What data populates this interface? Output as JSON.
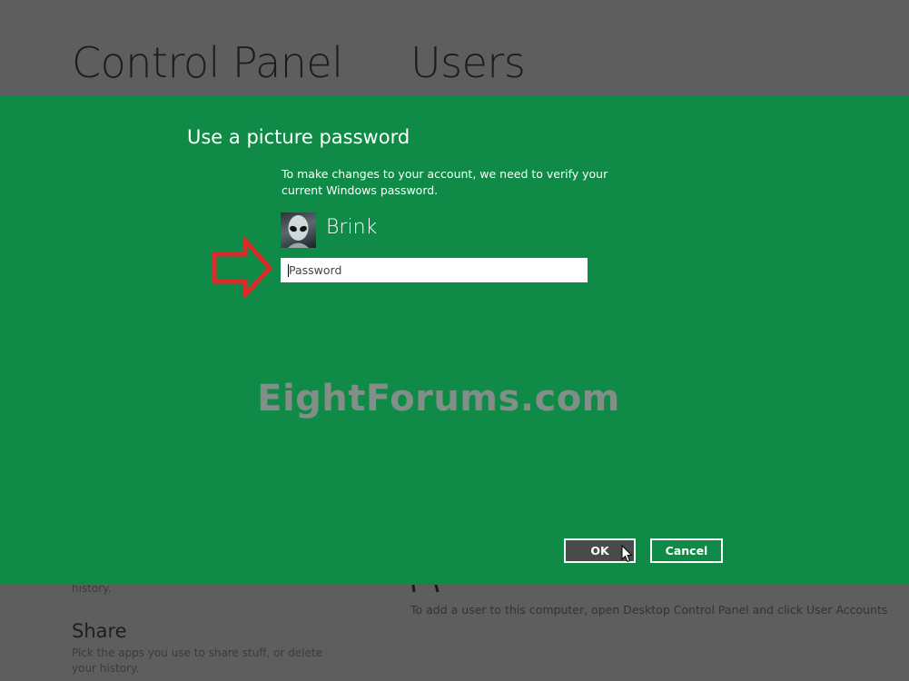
{
  "background": {
    "title_left": "Control Panel",
    "title_right": "Users",
    "fragment": "history.",
    "share": {
      "heading": "Share",
      "description": "Pick the apps you use to share stuff, or delete your history."
    },
    "add_user_text": "To add a user to this computer, open Desktop Control Panel and click User Accounts"
  },
  "dialog": {
    "title": "Use a picture password",
    "message": "To make changes to your account, we need to verify your current Windows password.",
    "user": {
      "name": "Brink",
      "avatar_icon": "alien-avatar"
    },
    "password": {
      "placeholder": "Password",
      "value": ""
    },
    "annotation_icon": "red-arrow-right-icon",
    "ok_label": "OK",
    "cancel_label": "Cancel"
  },
  "watermark": "EightForums.com",
  "colors": {
    "dialog_bg": "#0f8b47",
    "page_bg": "#5e5e5e",
    "arrow": "#e02a2a",
    "ok_bg": "#4a4a4a"
  }
}
